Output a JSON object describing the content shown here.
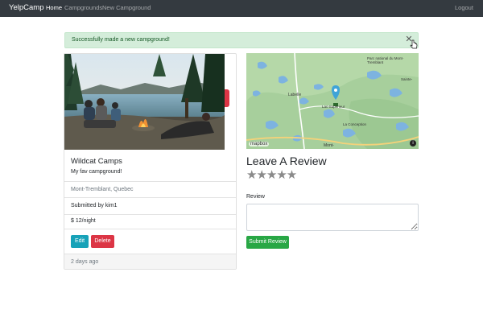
{
  "navbar": {
    "brand": "YelpCamp",
    "links": [
      "Home",
      "Campgrounds",
      "New Campground"
    ],
    "logout": "Logout"
  },
  "alert": {
    "message": "Successfully made a new campground!",
    "close_icon": "close-icon"
  },
  "campground": {
    "title": "Wildcat Camps",
    "description": "My fav campground!",
    "location": "Mont-Tremblant, Quebec",
    "submitted_by": "Submitted by kim1",
    "price": "$ 12/night",
    "edit_label": "Edit",
    "delete_label": "Delete",
    "posted": "2 days ago"
  },
  "map": {
    "attribution": "mapbox",
    "labels": {
      "lake_label": "Labelle",
      "station": "Mont-",
      "conception": "La Conception",
      "park": "Parc national du Mont-Tremblant",
      "lac_superieur": "Lac-Supérieur",
      "sainte_agathe": "Sainte-"
    }
  },
  "review": {
    "heading": "Leave A Review",
    "stars": "★★★★★",
    "label": "Review",
    "submit_label": "Submit Review"
  },
  "colors": {
    "navbar": "#343a40",
    "alert_bg": "#d4edda",
    "alert_text": "#155724",
    "edit": "#17a2b8",
    "delete": "#dc3545",
    "submit": "#28a745"
  }
}
